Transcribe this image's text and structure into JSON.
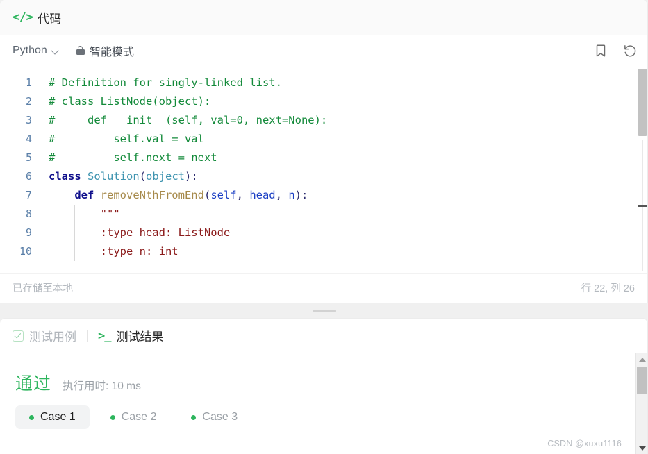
{
  "header": {
    "icon": "code-brackets-icon",
    "title": "代码"
  },
  "toolbar": {
    "language": "Python",
    "chevron_icon": "chevron-down-icon",
    "lock_icon": "lock-icon",
    "smart_mode": "智能模式",
    "bookmark_icon": "bookmark-icon",
    "reset_icon": "undo-reset-icon"
  },
  "editor": {
    "lines": [
      {
        "no": "1",
        "indent_guides": 0,
        "tokens": [
          {
            "t": "# Definition for singly-linked list.",
            "c": "tok-com"
          }
        ]
      },
      {
        "no": "2",
        "indent_guides": 0,
        "tokens": [
          {
            "t": "# class ListNode(object):",
            "c": "tok-com"
          }
        ]
      },
      {
        "no": "3",
        "indent_guides": 0,
        "tokens": [
          {
            "t": "#     def __init__(self, val=0, next=None):",
            "c": "tok-com"
          }
        ]
      },
      {
        "no": "4",
        "indent_guides": 0,
        "tokens": [
          {
            "t": "#         self.val = val",
            "c": "tok-com"
          }
        ]
      },
      {
        "no": "5",
        "indent_guides": 0,
        "tokens": [
          {
            "t": "#         self.next = next",
            "c": "tok-com"
          }
        ]
      },
      {
        "no": "6",
        "indent_guides": 0,
        "tokens": [
          {
            "t": "class ",
            "c": "tok-kw"
          },
          {
            "t": "Solution",
            "c": "tok-cls"
          },
          {
            "t": "(",
            "c": "tok-punct"
          },
          {
            "t": "object",
            "c": "tok-cls"
          },
          {
            "t": "):",
            "c": "tok-punct"
          }
        ]
      },
      {
        "no": "7",
        "indent_guides": 1,
        "tokens": [
          {
            "t": "    ",
            "c": "tok-plain"
          },
          {
            "t": "def ",
            "c": "tok-kw"
          },
          {
            "t": "removeNthFromEnd",
            "c": "tok-fn"
          },
          {
            "t": "(",
            "c": "tok-punct"
          },
          {
            "t": "self",
            "c": "tok-param"
          },
          {
            "t": ", ",
            "c": "tok-punct"
          },
          {
            "t": "head",
            "c": "tok-param"
          },
          {
            "t": ", ",
            "c": "tok-punct"
          },
          {
            "t": "n",
            "c": "tok-param"
          },
          {
            "t": "):",
            "c": "tok-punct"
          }
        ]
      },
      {
        "no": "8",
        "indent_guides": 2,
        "tokens": [
          {
            "t": "        ",
            "c": "tok-plain"
          },
          {
            "t": "\"\"\"",
            "c": "tok-str"
          }
        ]
      },
      {
        "no": "9",
        "indent_guides": 2,
        "tokens": [
          {
            "t": "        ",
            "c": "tok-plain"
          },
          {
            "t": ":type head: ListNode",
            "c": "tok-str"
          }
        ]
      },
      {
        "no": "10",
        "indent_guides": 2,
        "tokens": [
          {
            "t": "        ",
            "c": "tok-plain"
          },
          {
            "t": ":type n: int",
            "c": "tok-str"
          }
        ]
      }
    ]
  },
  "status": {
    "saved": "已存储至本地",
    "cursor": "行 22, 列 26"
  },
  "results": {
    "tabs": [
      {
        "label": "测试用例",
        "icon": "checkbox-check-icon",
        "active": false
      },
      {
        "label": "测试结果",
        "icon": "terminal-prompt-icon",
        "active": true
      }
    ],
    "verdict": "通过",
    "runtime": "执行用时: 10 ms",
    "cases": [
      {
        "label": "Case 1",
        "active": true
      },
      {
        "label": "Case 2",
        "active": false
      },
      {
        "label": "Case 3",
        "active": false
      }
    ]
  },
  "watermark": "CSDN @xuxu1116",
  "colors": {
    "accent_green": "#2db55d",
    "comment_green": "#138a3a",
    "keyword_blue": "#10108c",
    "docstring_red": "#8b1a1a",
    "muted_text": "#b4b9bf"
  }
}
